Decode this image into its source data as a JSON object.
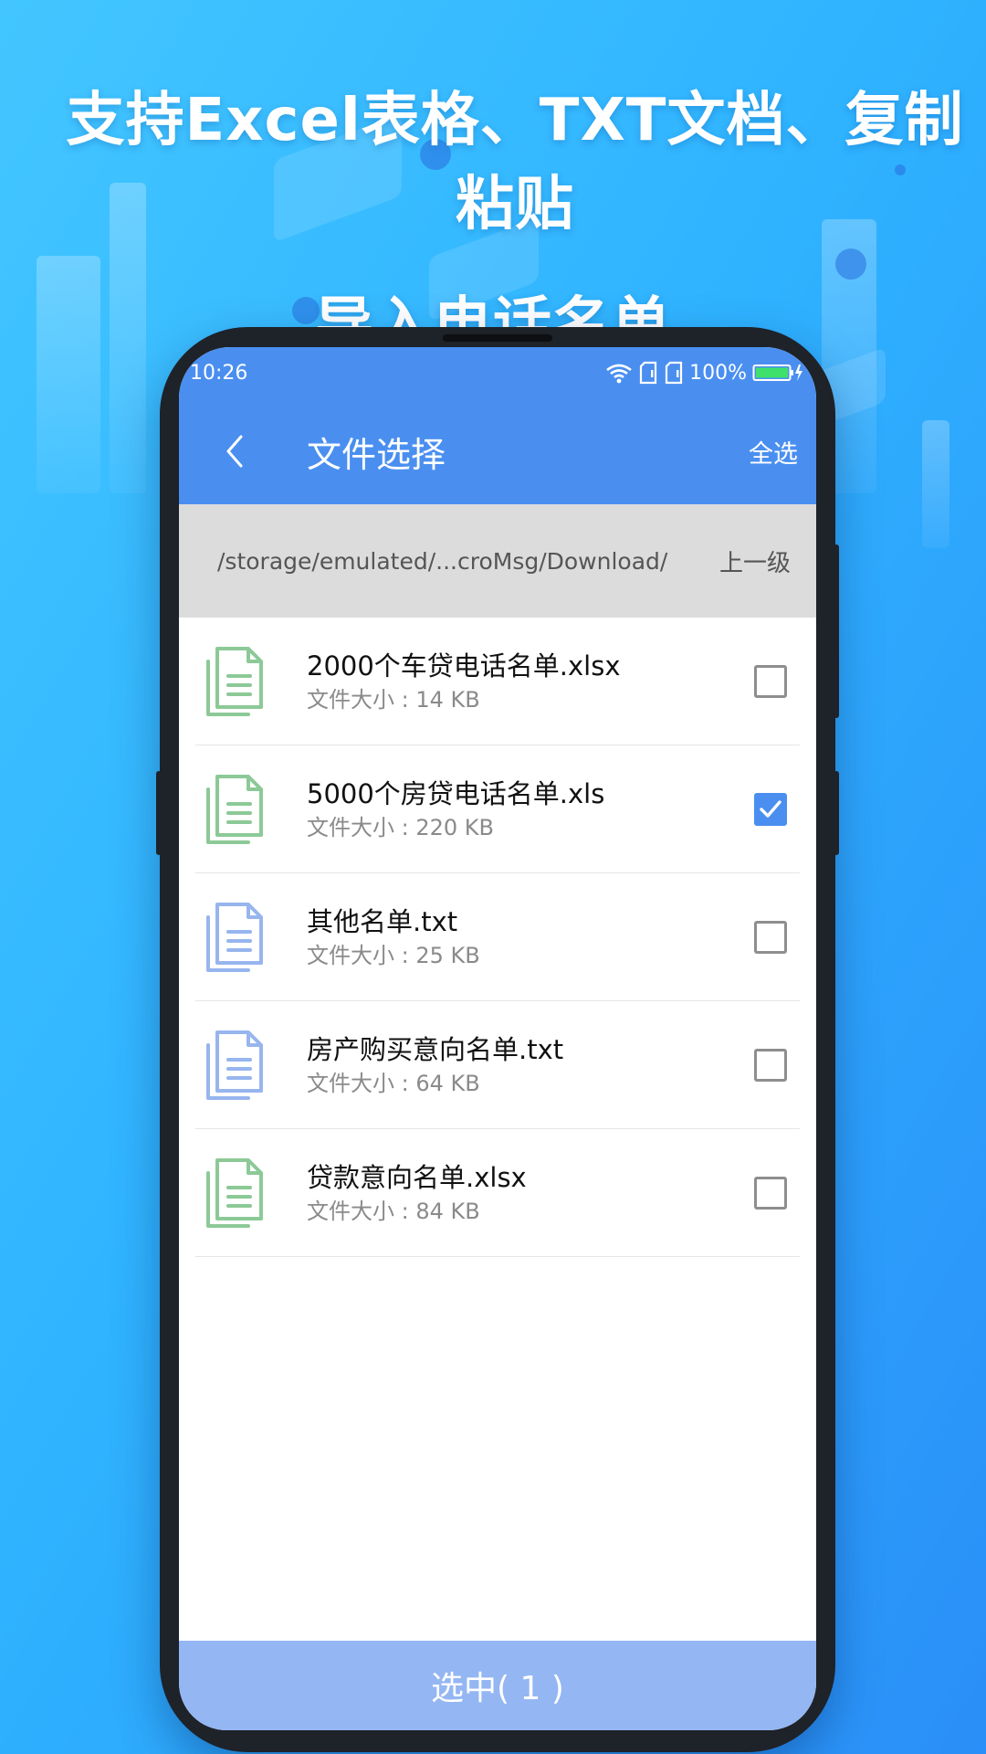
{
  "headline": {
    "line1": "支持Excel表格、TXT文档、复制粘贴",
    "line2": "导入电话名单"
  },
  "status_bar": {
    "time": "10:26",
    "battery": "100%"
  },
  "app_bar": {
    "title": "文件选择",
    "select_all": "全选"
  },
  "path_bar": {
    "path": "/storage/emulated/...croMsg/Download/",
    "up_level": "上一级"
  },
  "files": [
    {
      "name": "2000个车贷电话名单.xlsx",
      "size": "文件大小 : 14 KB",
      "type": "excel",
      "checked": false
    },
    {
      "name": "5000个房贷电话名单.xls",
      "size": "文件大小 : 220 KB",
      "type": "excel",
      "checked": true
    },
    {
      "name": "其他名单.txt",
      "size": "文件大小 : 25 KB",
      "type": "text",
      "checked": false
    },
    {
      "name": "房产购买意向名单.txt",
      "size": "文件大小 : 64 KB",
      "type": "text",
      "checked": false
    },
    {
      "name": "贷款意向名单.xlsx",
      "size": "文件大小 : 84 KB",
      "type": "excel",
      "checked": false
    }
  ],
  "confirm": {
    "label": "选中( 1 )"
  },
  "colors": {
    "primary": "#4a8ff0",
    "excel_icon": "#8cc997",
    "text_icon": "#97b5ee",
    "confirm_bg": "#94b6f3"
  }
}
